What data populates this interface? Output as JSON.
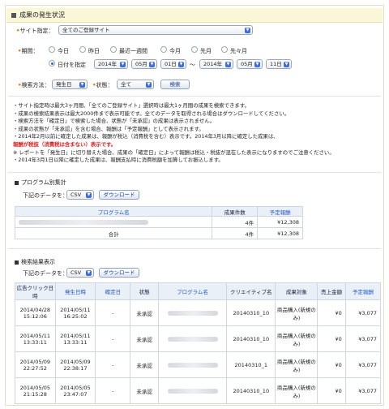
{
  "header": {
    "title": "成果の発生状況"
  },
  "site": {
    "label": "サイト指定：",
    "selected": "全てのご登録サイト"
  },
  "period": {
    "label": "期間：",
    "options": [
      "今日",
      "昨日",
      "最近一週間",
      "今月",
      "先月",
      "先々月"
    ],
    "date_label": "日付を指定",
    "from": {
      "year": "2014年",
      "month": "05月",
      "day": "01日"
    },
    "sep": "〜",
    "to": {
      "year": "2014年",
      "month": "05月",
      "day": "11日"
    }
  },
  "search": {
    "method_label": "検索方法：",
    "method_value": "発生日",
    "status_label": "状態：",
    "status_value": "全て",
    "button": "検索"
  },
  "notes": [
    "・サイト指定時は最大3ヶ月間、「全てのご登録サイト」選択時は最大1ヶ月間の成果を検索できます。",
    "・成果の検索結果表示は最大2000件まで表示可能です。全てのデータを取得される場合はダウンロードしてください。",
    "・検索方法を「確定日」で検索した場合、状態が「未承認」の成果は表示されません。",
    "・成果の状態が「未承認」を含む場合、報酬は「予定報酬」として表示されます。",
    "・2014年2月以前に確定した成果は、報酬が税込（消費税を含む）表示です。2014年3月以降に確定した成果は、",
    "報酬が税抜（消費税は含まない）表示です。",
    "※ レポートを「発生日」に切り替えた場合、成果の「確定日」によって報酬は税込・税抜が混在した表示になりますのでご注意ください。",
    "・2014年3月1日以降に確定した成果は、報酬支払時に消費税額を加算してお振込します。"
  ],
  "program_summary": {
    "title": "プログラム別集計",
    "download_label": "下記のデータを：",
    "format": "CSV",
    "download_button": "ダウンロード",
    "columns": [
      "プログラム名",
      "成果件数",
      "予定報酬"
    ],
    "rows": [
      {
        "count": "4件",
        "reward": "¥12,308"
      }
    ],
    "total": {
      "label": "合計",
      "count": "4件",
      "reward": "¥12,308"
    }
  },
  "results": {
    "title": "検索結果表示",
    "download_label": "下記のデータを：",
    "format": "CSV",
    "download_button": "ダウンロード",
    "columns": [
      "広告クリック日時",
      "発生日時",
      "確定日",
      "状態",
      "プログラム名",
      "クリエイティブ名",
      "成果対象",
      "売上金額",
      "予定報酬"
    ],
    "rows": [
      {
        "click_date": "2014/04/28",
        "click_time": "15:12:06",
        "occur_date": "2014/05/11",
        "occur_time": "16:25:02",
        "confirm": "-",
        "status": "未承認",
        "creative": "20140310_10",
        "target": "商品購入(新規のみ)",
        "sales": "¥0",
        "reward": "¥3,077"
      },
      {
        "click_date": "2014/05/11",
        "click_time": "13:33:11",
        "occur_date": "2014/05/11",
        "occur_time": "13:33:11",
        "confirm": "-",
        "status": "未承認",
        "creative": "20140310_10",
        "target": "商品購入(新規のみ)",
        "sales": "¥0",
        "reward": "¥3,077"
      },
      {
        "click_date": "2014/05/09",
        "click_time": "22:27:52",
        "occur_date": "2014/05/09",
        "occur_time": "22:38:17",
        "confirm": "-",
        "status": "未承認",
        "creative": "20140310_1",
        "target": "商品購入(新規のみ)",
        "sales": "¥0",
        "reward": "¥3,077"
      },
      {
        "click_date": "2014/05/05",
        "click_time": "21:15:28",
        "occur_date": "2014/05/05",
        "occur_time": "23:47:07",
        "confirm": "-",
        "status": "未承認",
        "creative": "20140310_10",
        "target": "商品購入(新規のみ)",
        "sales": "¥0",
        "reward": "¥3,077"
      }
    ]
  },
  "colors": {
    "accent": "#e07a00",
    "link": "#2158c7",
    "warning": "#e02020",
    "header_bg": "#faf7d9"
  }
}
